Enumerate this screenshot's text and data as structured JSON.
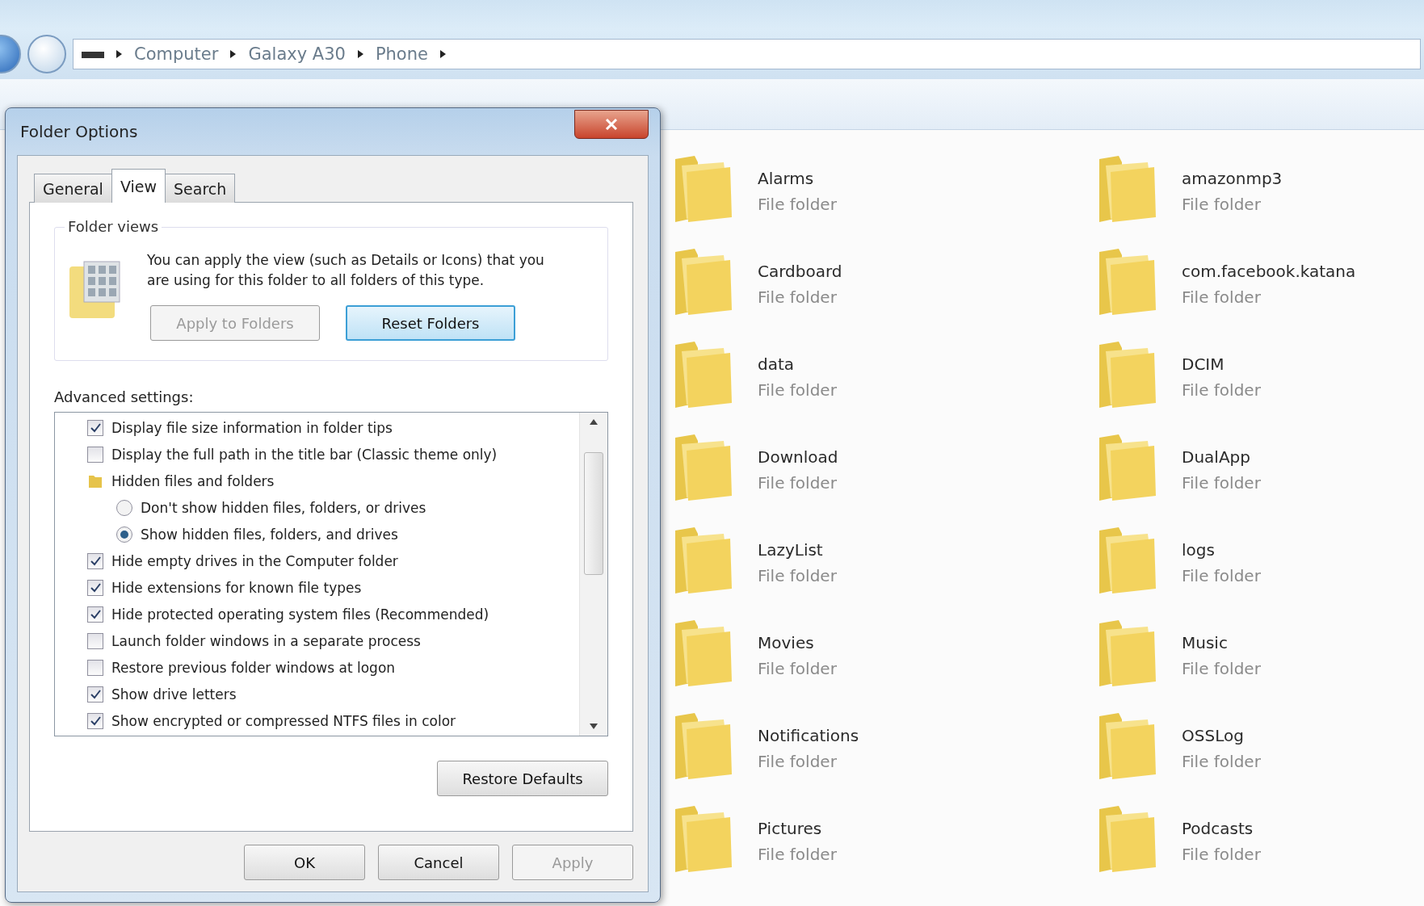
{
  "address": {
    "path": [
      "Computer",
      "Galaxy A30",
      "Phone"
    ]
  },
  "dialog": {
    "title": "Folder Options",
    "tabs": [
      {
        "label": "General",
        "selected": false
      },
      {
        "label": "View",
        "selected": true
      },
      {
        "label": "Search",
        "selected": false
      }
    ],
    "folder_views": {
      "title": "Folder views",
      "description": "You can apply the view (such as Details or Icons) that you are using for this folder to all folders of this type.",
      "buttons": [
        {
          "label": "Apply to Folders",
          "disabled": true,
          "default": false
        },
        {
          "label": "Reset Folders",
          "disabled": false,
          "default": true
        }
      ]
    },
    "advanced_label": "Advanced settings:",
    "settings": [
      {
        "kind": "checkbox",
        "label": "Display file size information in folder tips",
        "checked": true
      },
      {
        "kind": "checkbox",
        "label": "Display the full path in the title bar (Classic theme only)",
        "checked": false
      },
      {
        "kind": "folder",
        "label": "Hidden files and folders"
      },
      {
        "kind": "radio",
        "label": "Don't show hidden files, folders, or drives",
        "selected": false
      },
      {
        "kind": "radio",
        "label": "Show hidden files, folders, and drives",
        "selected": true
      },
      {
        "kind": "checkbox",
        "label": "Hide empty drives in the Computer folder",
        "checked": true
      },
      {
        "kind": "checkbox",
        "label": "Hide extensions for known file types",
        "checked": true
      },
      {
        "kind": "checkbox",
        "label": "Hide protected operating system files (Recommended)",
        "checked": true
      },
      {
        "kind": "checkbox",
        "label": "Launch folder windows in a separate process",
        "checked": false
      },
      {
        "kind": "checkbox",
        "label": "Restore previous folder windows at logon",
        "checked": false
      },
      {
        "kind": "checkbox",
        "label": "Show drive letters",
        "checked": true
      },
      {
        "kind": "checkbox",
        "label": "Show encrypted or compressed NTFS files in color",
        "checked": true
      }
    ],
    "restore_button": "Restore Defaults",
    "footer_buttons": [
      {
        "label": "OK",
        "disabled": false
      },
      {
        "label": "Cancel",
        "disabled": false
      },
      {
        "label": "Apply",
        "disabled": true
      }
    ]
  },
  "files": [
    {
      "name": "Alarms",
      "type": "File folder"
    },
    {
      "name": "amazonmp3",
      "type": "File folder"
    },
    {
      "name": "Cardboard",
      "type": "File folder"
    },
    {
      "name": "com.facebook.katana",
      "type": "File folder"
    },
    {
      "name": "data",
      "type": "File folder"
    },
    {
      "name": "DCIM",
      "type": "File folder"
    },
    {
      "name": "Download",
      "type": "File folder"
    },
    {
      "name": "DualApp",
      "type": "File folder"
    },
    {
      "name": "LazyList",
      "type": "File folder"
    },
    {
      "name": "logs",
      "type": "File folder"
    },
    {
      "name": "Movies",
      "type": "File folder"
    },
    {
      "name": "Music",
      "type": "File folder"
    },
    {
      "name": "Notifications",
      "type": "File folder"
    },
    {
      "name": "OSSLog",
      "type": "File folder"
    },
    {
      "name": "Pictures",
      "type": "File folder"
    },
    {
      "name": "Podcasts",
      "type": "File folder"
    }
  ]
}
